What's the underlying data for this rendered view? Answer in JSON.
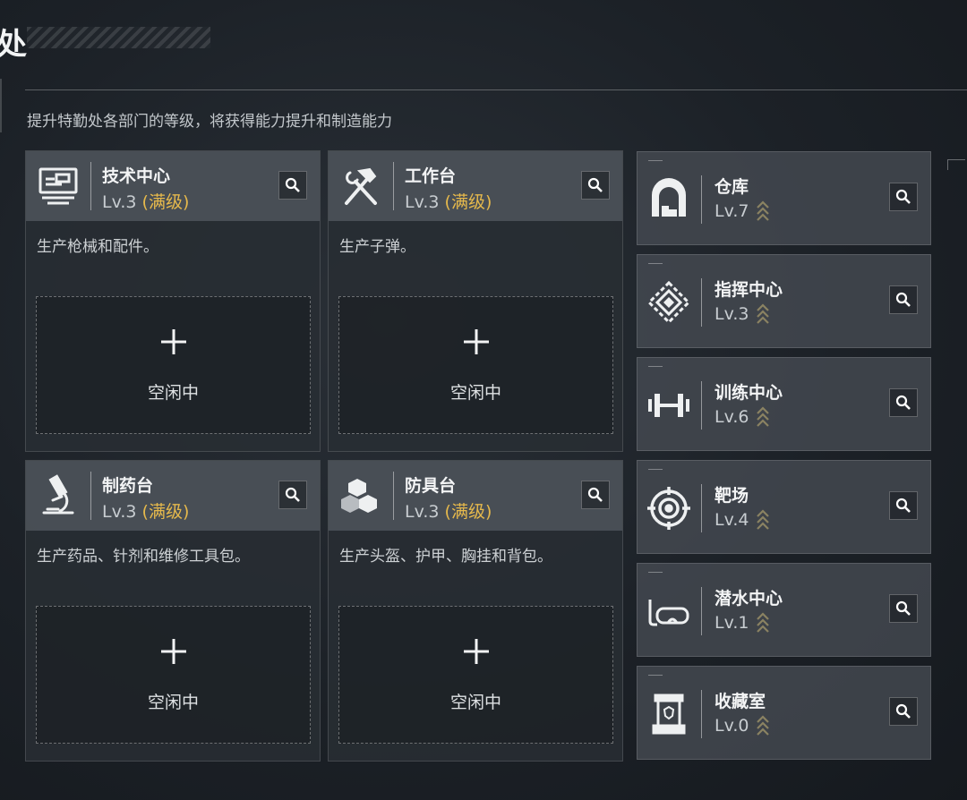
{
  "header": {
    "title_fragment": "处",
    "subtitle": "提升特勤处各部门的等级，将获得能力提升和制造能力"
  },
  "production_cards": [
    {
      "name": "技术中心",
      "level": "Lv.3",
      "status": "(满级)",
      "description": "生产枪械和配件。",
      "slot_status": "空闲中",
      "icon": "computer-terminal-icon"
    },
    {
      "name": "工作台",
      "level": "Lv.3",
      "status": "(满级)",
      "description": "生产子弹。",
      "slot_status": "空闲中",
      "icon": "hammer-wrench-icon"
    },
    {
      "name": "制药台",
      "level": "Lv.3",
      "status": "(满级)",
      "description": "生产药品、针剂和维修工具包。",
      "slot_status": "空闲中",
      "icon": "microscope-icon"
    },
    {
      "name": "防具台",
      "level": "Lv.3",
      "status": "(满级)",
      "description": "生产头盔、护甲、胸挂和背包。",
      "slot_status": "空闲中",
      "icon": "cubes-icon"
    }
  ],
  "facilities": [
    {
      "name": "仓库",
      "level": "Lv.7",
      "icon": "warehouse-icon"
    },
    {
      "name": "指挥中心",
      "level": "Lv.3",
      "icon": "command-chip-icon"
    },
    {
      "name": "训练中心",
      "level": "Lv.6",
      "icon": "dumbbell-icon"
    },
    {
      "name": "靶场",
      "level": "Lv.4",
      "icon": "target-icon"
    },
    {
      "name": "潜水中心",
      "level": "Lv.1",
      "icon": "diving-mask-icon"
    },
    {
      "name": "收藏室",
      "level": "Lv.0",
      "icon": "display-case-icon"
    }
  ],
  "colors": {
    "maxed_level": "#e6b94c",
    "upgrade_chevron": "#8a8262"
  }
}
